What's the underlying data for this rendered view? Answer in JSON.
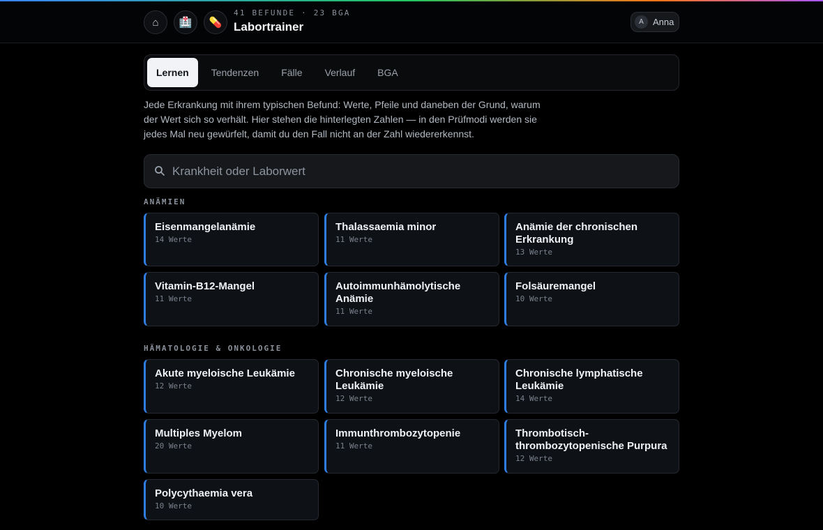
{
  "header": {
    "home_icon": "⌂",
    "lab_icon": "🏥",
    "pill_icon": "💊",
    "subtitle": "41 BEFUNDE · 23 BGA",
    "title": "Labortrainer",
    "user_initial": "A",
    "user_name": "Anna"
  },
  "tabs": [
    {
      "label": "Lernen",
      "active": true
    },
    {
      "label": "Tendenzen",
      "active": false
    },
    {
      "label": "Fälle",
      "active": false
    },
    {
      "label": "Verlauf",
      "active": false
    },
    {
      "label": "BGA",
      "active": false
    }
  ],
  "intro": "Jede Erkrankung mit ihrem typischen Befund: Werte, Pfeile und daneben der Grund, warum der Wert sich so verhält. Hier stehen die hinterlegten Zahlen — in den Prüfmodi werden sie jedes Mal neu gewürfelt, damit du den Fall nicht an der Zahl wiedererkennst.",
  "search": {
    "placeholder": "Krankheit oder Laborwert",
    "value": ""
  },
  "sections": [
    {
      "title": "ANÄMIEN",
      "cards": [
        {
          "name": "Eisenmangelanämie",
          "count": "14 Werte"
        },
        {
          "name": "Thalassaemia minor",
          "count": "11 Werte"
        },
        {
          "name": "Anämie der chronischen Erkrankung",
          "count": "13 Werte"
        },
        {
          "name": "Vitamin-B12-Mangel",
          "count": "11 Werte"
        },
        {
          "name": "Autoimmunhämolytische Anämie",
          "count": "11 Werte"
        },
        {
          "name": "Folsäuremangel",
          "count": "10 Werte"
        }
      ]
    },
    {
      "title": "HÄMATOLOGIE & ONKOLOGIE",
      "cards": [
        {
          "name": "Akute myeloische Leukämie",
          "count": "12 Werte"
        },
        {
          "name": "Chronische myeloische Leukämie",
          "count": "12 Werte"
        },
        {
          "name": "Chronische lymphatische Leukämie",
          "count": "14 Werte"
        },
        {
          "name": "Multiples Myelom",
          "count": "20 Werte"
        },
        {
          "name": "Immunthrombozytopenie",
          "count": "11 Werte"
        },
        {
          "name": "Thrombotisch-thrombozytopenische Purpura",
          "count": "12 Werte"
        },
        {
          "name": "Polycythaemia vera",
          "count": "10 Werte"
        }
      ]
    }
  ],
  "colors": {
    "accent": "#2f7de1",
    "card_bg": "#0e1116",
    "page_bg": "#000000"
  }
}
